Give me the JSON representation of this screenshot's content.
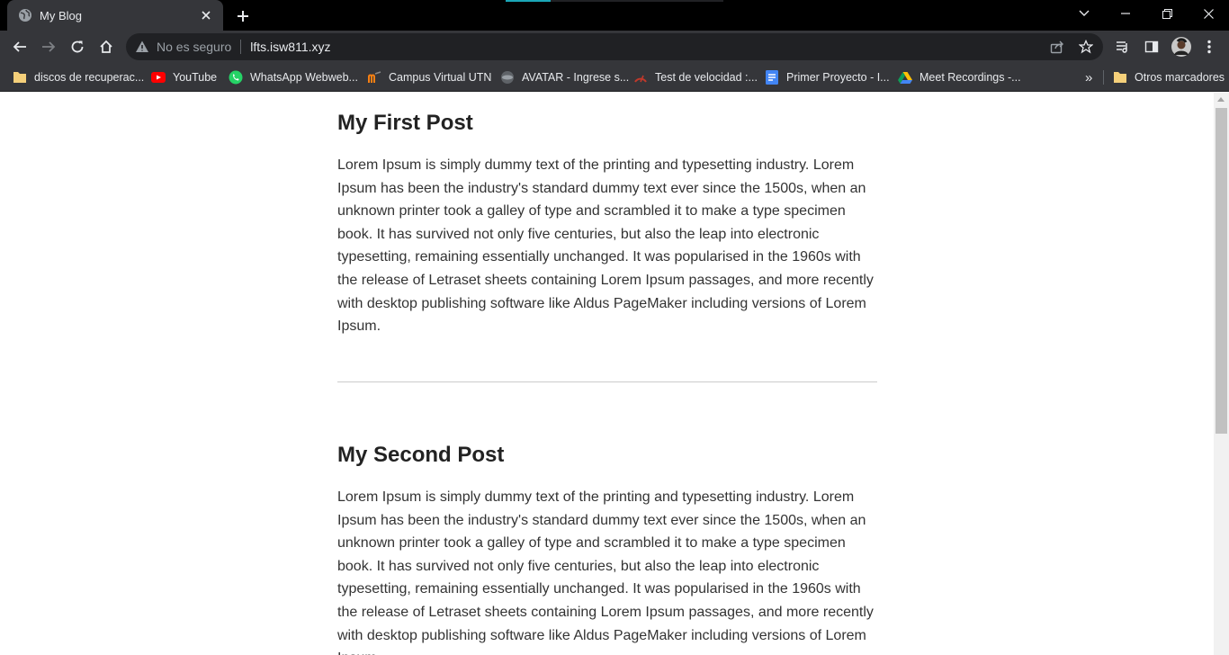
{
  "browser": {
    "tab": {
      "title": "My Blog"
    },
    "omnibox": {
      "security_label": "No es seguro",
      "url": "lfts.isw811.xyz"
    },
    "bookmarks": [
      {
        "label": "discos de recuperac...",
        "icon": "folder-icon"
      },
      {
        "label": "YouTube",
        "icon": "youtube-icon"
      },
      {
        "label": "WhatsApp Webweb...",
        "icon": "whatsapp-icon"
      },
      {
        "label": "Campus Virtual UTN",
        "icon": "moodle-icon"
      },
      {
        "label": "AVATAR - Ingrese s...",
        "icon": "avatar-site-icon"
      },
      {
        "label": "Test de velocidad :...",
        "icon": "speedtest-icon"
      },
      {
        "label": "Primer Proyecto - I...",
        "icon": "docs-icon"
      },
      {
        "label": "Meet Recordings -...",
        "icon": "drive-icon"
      }
    ],
    "overflow_label": "»",
    "other_bookmarks": "Otros marcadores"
  },
  "posts": [
    {
      "title": "My First Post",
      "body": "Lorem Ipsum is simply dummy text of the printing and typesetting industry. Lorem Ipsum has been the industry's standard dummy text ever since the 1500s, when an unknown printer took a galley of type and scrambled it to make a type specimen book. It has survived not only five centuries, but also the leap into electronic typesetting, remaining essentially unchanged. It was popularised in the 1960s with the release of Letraset sheets containing Lorem Ipsum passages, and more recently with desktop publishing software like Aldus PageMaker including versions of Lorem Ipsum."
    },
    {
      "title": "My Second Post",
      "body": "Lorem Ipsum is simply dummy text of the printing and typesetting industry. Lorem Ipsum has been the industry's standard dummy text ever since the 1500s, when an unknown printer took a galley of type and scrambled it to make a type specimen book. It has survived not only five centuries, but also the leap into electronic typesetting, remaining essentially unchanged. It was popularised in the 1960s with the release of Letraset sheets containing Lorem Ipsum passages, and more recently with desktop publishing software like Aldus PageMaker including versions of Lorem Ipsum."
    }
  ]
}
